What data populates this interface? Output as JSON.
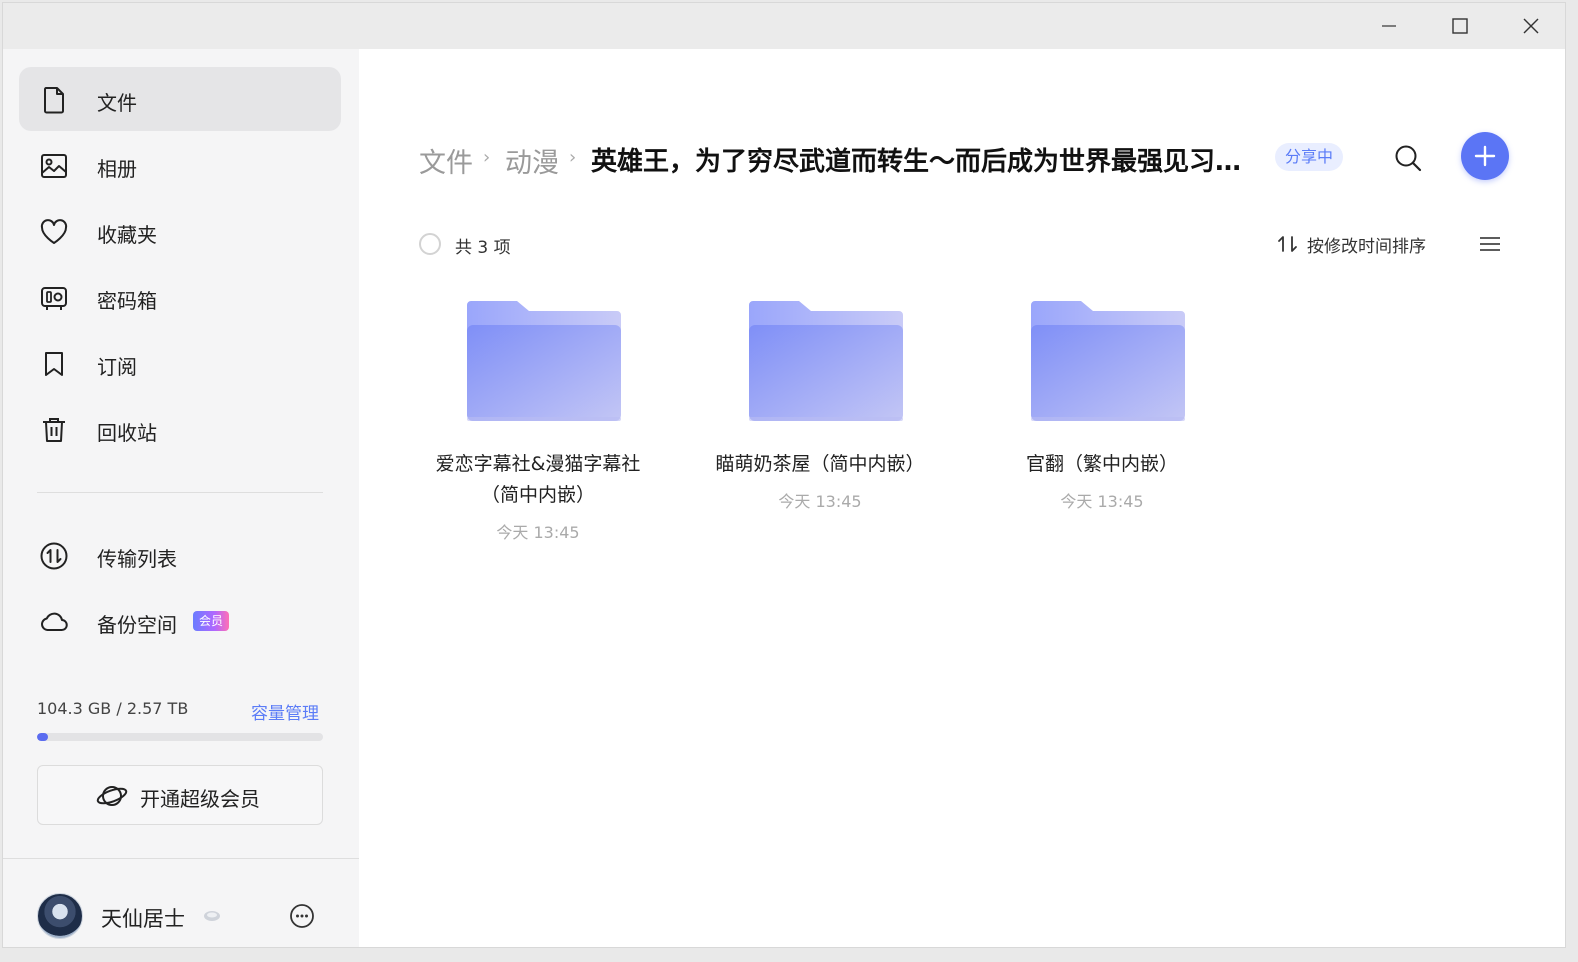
{
  "sidebar": {
    "nav": [
      {
        "label": "文件",
        "icon": "file-icon"
      },
      {
        "label": "相册",
        "icon": "photo-album-icon"
      },
      {
        "label": "收藏夹",
        "icon": "heart-icon"
      },
      {
        "label": "密码箱",
        "icon": "safe-icon"
      },
      {
        "label": "订阅",
        "icon": "bookmark-icon"
      },
      {
        "label": "回收站",
        "icon": "trash-icon"
      },
      {
        "label": "传输列表",
        "icon": "transfer-icon"
      },
      {
        "label": "备份空间",
        "icon": "cloud-icon",
        "badge": "会员"
      }
    ],
    "storage": {
      "text": "104.3 GB / 2.57 TB",
      "link": "容量管理",
      "used_fraction": 0.04
    },
    "vip_button": "开通超级会员",
    "user": {
      "name": "天仙居士"
    }
  },
  "main": {
    "breadcrumb": [
      "文件",
      "动漫"
    ],
    "current": "英雄王，为了穷尽武道而转生～而后成为世界最强见习骑士♀",
    "share_badge": "分享中",
    "count": "共 3 项",
    "sort_label": "按修改时间排序",
    "folders": [
      {
        "name": "爱恋字幕社&漫猫字幕社（简中内嵌）",
        "time": "今天 13:45"
      },
      {
        "name": "瞄萌奶茶屋（简中内嵌）",
        "time": "今天 13:45"
      },
      {
        "name": "官翻（繁中内嵌）",
        "time": "今天 13:45"
      }
    ]
  },
  "colors": {
    "accent": "#5b75f5",
    "folder_start": "#7f8ff7",
    "folder_end": "#c3c6f5"
  }
}
